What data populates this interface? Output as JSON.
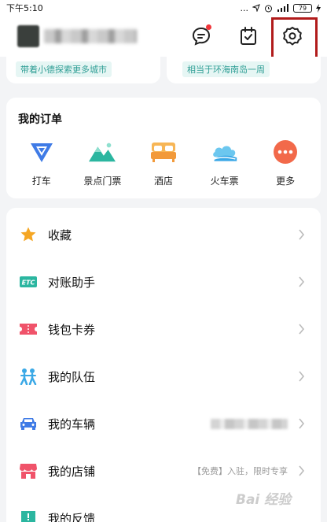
{
  "status_bar": {
    "time": "下午5:10",
    "dots": "...",
    "battery": "79"
  },
  "header": {
    "icons": [
      "message-icon",
      "task-check-icon",
      "settings-gear-icon"
    ],
    "accent_red": "#b11b1b",
    "notification_dot_color": "#f0353a"
  },
  "promo": {
    "left_tag": "带着小德探索更多城市",
    "right_tag": "相当于环海南岛一周",
    "tag_color": "#2f9e95"
  },
  "orders": {
    "title": "我的订单",
    "items": [
      {
        "label": "打车",
        "icon": "taxi-icon",
        "color": "#3f7be6"
      },
      {
        "label": "景点门票",
        "icon": "scenic-mountain-icon",
        "color": "#2bb6a0"
      },
      {
        "label": "酒店",
        "icon": "hotel-bed-icon",
        "color": "#f29a3a"
      },
      {
        "label": "火车票",
        "icon": "train-cloud-icon",
        "color": "#3aa8e6"
      },
      {
        "label": "更多",
        "icon": "more-dots-icon",
        "color": "#f2694a"
      }
    ]
  },
  "menu": [
    {
      "label": "收藏",
      "icon": "star-icon",
      "sub": ""
    },
    {
      "label": "对账助手",
      "icon": "etc-icon",
      "icon_text": "ETC",
      "sub": ""
    },
    {
      "label": "钱包卡券",
      "icon": "ticket-icon",
      "sub": ""
    },
    {
      "label": "我的队伍",
      "icon": "team-icon",
      "sub": ""
    },
    {
      "label": "我的车辆",
      "icon": "car-icon",
      "sub": ""
    },
    {
      "label": "我的店铺",
      "icon": "shop-icon",
      "sub": "【免费】入驻，限时专享"
    },
    {
      "label": "我的反馈",
      "icon": "feedback-icon",
      "sub": ""
    }
  ],
  "watermark": "Bai 经验"
}
